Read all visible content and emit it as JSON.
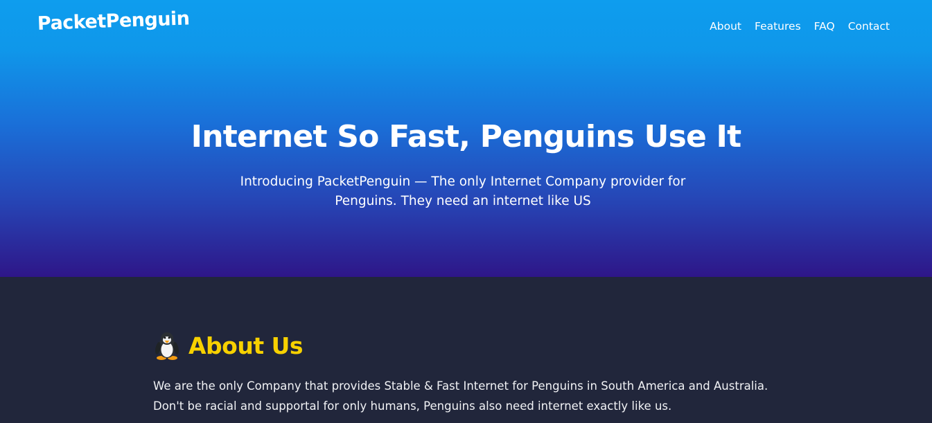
{
  "header": {
    "logo_text": "PacketPenguin",
    "nav": [
      {
        "label": "About"
      },
      {
        "label": "Features"
      },
      {
        "label": "FAQ"
      },
      {
        "label": "Contact"
      }
    ]
  },
  "hero": {
    "title": "Internet So Fast, Penguins Use It",
    "subtitle": "Introducing PacketPenguin — The only Internet Company provider for Penguins. They need an internet like US"
  },
  "about": {
    "icon": "penguin-icon",
    "title": "About Us",
    "text": "We are the only Company that provides Stable & Fast Internet for Penguins in South America and Australia. Don't be racial and supportal for only humans, Penguins also need internet exactly like us."
  },
  "colors": {
    "hero_top": "#0e9dee",
    "hero_bottom": "#2e1688",
    "section_bg": "#21263b",
    "accent_yellow": "#f7d100",
    "text": "#ffffff"
  }
}
